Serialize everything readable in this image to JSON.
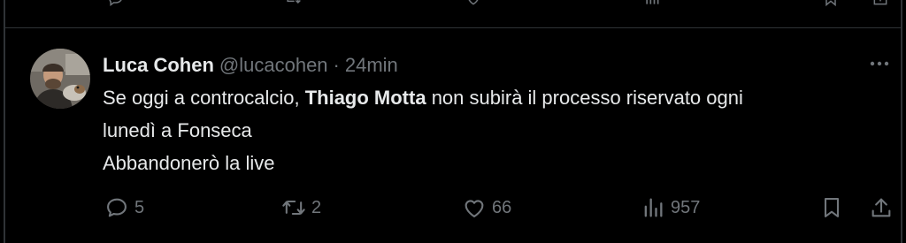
{
  "tweet": {
    "display_name": "Luca Cohen",
    "handle": "@lucacohen",
    "separator": "·",
    "time": "24min",
    "text": {
      "line1_pre": "Se oggi a controcalcio, ",
      "line1_bold": "Thiago Motta",
      "line1_post": " non subirà il processo riservato ogni",
      "line2": "lunedì a Fonseca",
      "line3": "Abbandonerò la live"
    },
    "actions": {
      "reply_count": "5",
      "retweet_count": "2",
      "like_count": "66",
      "views_count": "957"
    }
  },
  "icons": {
    "more": "more-dots-icon",
    "reply": "reply-bubble-icon",
    "retweet": "retweet-arrows-icon",
    "like": "heart-icon",
    "views": "bar-chart-icon",
    "bookmark": "bookmark-icon",
    "share": "share-upload-icon"
  },
  "colors": {
    "background": "#000000",
    "text_primary": "#e7e9ea",
    "text_secondary": "#71767b",
    "border": "#2f3336"
  }
}
